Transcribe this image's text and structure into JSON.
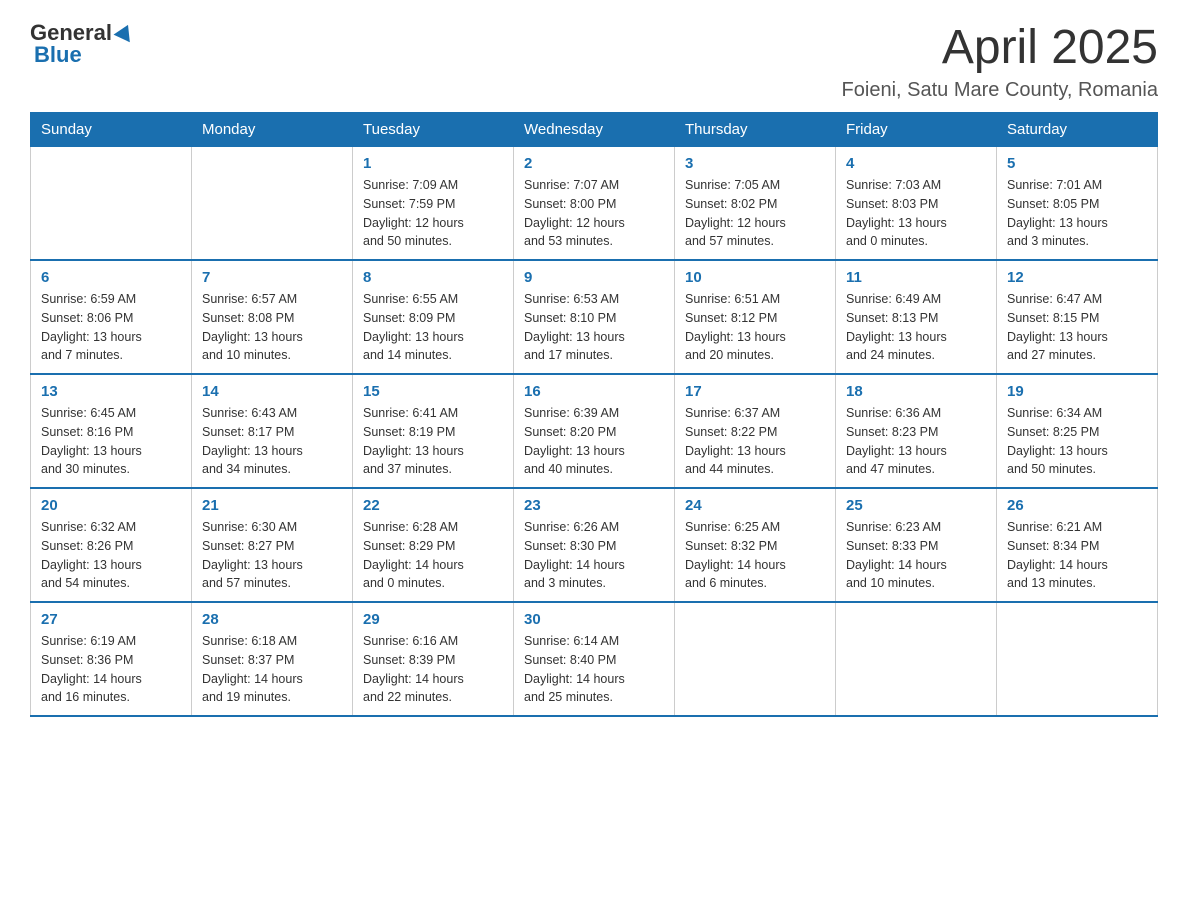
{
  "header": {
    "logo_general": "General",
    "logo_blue": "Blue",
    "month_title": "April 2025",
    "location": "Foieni, Satu Mare County, Romania"
  },
  "weekdays": [
    "Sunday",
    "Monday",
    "Tuesday",
    "Wednesday",
    "Thursday",
    "Friday",
    "Saturday"
  ],
  "weeks": [
    [
      {
        "day": "",
        "info": ""
      },
      {
        "day": "",
        "info": ""
      },
      {
        "day": "1",
        "info": "Sunrise: 7:09 AM\nSunset: 7:59 PM\nDaylight: 12 hours\nand 50 minutes."
      },
      {
        "day": "2",
        "info": "Sunrise: 7:07 AM\nSunset: 8:00 PM\nDaylight: 12 hours\nand 53 minutes."
      },
      {
        "day": "3",
        "info": "Sunrise: 7:05 AM\nSunset: 8:02 PM\nDaylight: 12 hours\nand 57 minutes."
      },
      {
        "day": "4",
        "info": "Sunrise: 7:03 AM\nSunset: 8:03 PM\nDaylight: 13 hours\nand 0 minutes."
      },
      {
        "day": "5",
        "info": "Sunrise: 7:01 AM\nSunset: 8:05 PM\nDaylight: 13 hours\nand 3 minutes."
      }
    ],
    [
      {
        "day": "6",
        "info": "Sunrise: 6:59 AM\nSunset: 8:06 PM\nDaylight: 13 hours\nand 7 minutes."
      },
      {
        "day": "7",
        "info": "Sunrise: 6:57 AM\nSunset: 8:08 PM\nDaylight: 13 hours\nand 10 minutes."
      },
      {
        "day": "8",
        "info": "Sunrise: 6:55 AM\nSunset: 8:09 PM\nDaylight: 13 hours\nand 14 minutes."
      },
      {
        "day": "9",
        "info": "Sunrise: 6:53 AM\nSunset: 8:10 PM\nDaylight: 13 hours\nand 17 minutes."
      },
      {
        "day": "10",
        "info": "Sunrise: 6:51 AM\nSunset: 8:12 PM\nDaylight: 13 hours\nand 20 minutes."
      },
      {
        "day": "11",
        "info": "Sunrise: 6:49 AM\nSunset: 8:13 PM\nDaylight: 13 hours\nand 24 minutes."
      },
      {
        "day": "12",
        "info": "Sunrise: 6:47 AM\nSunset: 8:15 PM\nDaylight: 13 hours\nand 27 minutes."
      }
    ],
    [
      {
        "day": "13",
        "info": "Sunrise: 6:45 AM\nSunset: 8:16 PM\nDaylight: 13 hours\nand 30 minutes."
      },
      {
        "day": "14",
        "info": "Sunrise: 6:43 AM\nSunset: 8:17 PM\nDaylight: 13 hours\nand 34 minutes."
      },
      {
        "day": "15",
        "info": "Sunrise: 6:41 AM\nSunset: 8:19 PM\nDaylight: 13 hours\nand 37 minutes."
      },
      {
        "day": "16",
        "info": "Sunrise: 6:39 AM\nSunset: 8:20 PM\nDaylight: 13 hours\nand 40 minutes."
      },
      {
        "day": "17",
        "info": "Sunrise: 6:37 AM\nSunset: 8:22 PM\nDaylight: 13 hours\nand 44 minutes."
      },
      {
        "day": "18",
        "info": "Sunrise: 6:36 AM\nSunset: 8:23 PM\nDaylight: 13 hours\nand 47 minutes."
      },
      {
        "day": "19",
        "info": "Sunrise: 6:34 AM\nSunset: 8:25 PM\nDaylight: 13 hours\nand 50 minutes."
      }
    ],
    [
      {
        "day": "20",
        "info": "Sunrise: 6:32 AM\nSunset: 8:26 PM\nDaylight: 13 hours\nand 54 minutes."
      },
      {
        "day": "21",
        "info": "Sunrise: 6:30 AM\nSunset: 8:27 PM\nDaylight: 13 hours\nand 57 minutes."
      },
      {
        "day": "22",
        "info": "Sunrise: 6:28 AM\nSunset: 8:29 PM\nDaylight: 14 hours\nand 0 minutes."
      },
      {
        "day": "23",
        "info": "Sunrise: 6:26 AM\nSunset: 8:30 PM\nDaylight: 14 hours\nand 3 minutes."
      },
      {
        "day": "24",
        "info": "Sunrise: 6:25 AM\nSunset: 8:32 PM\nDaylight: 14 hours\nand 6 minutes."
      },
      {
        "day": "25",
        "info": "Sunrise: 6:23 AM\nSunset: 8:33 PM\nDaylight: 14 hours\nand 10 minutes."
      },
      {
        "day": "26",
        "info": "Sunrise: 6:21 AM\nSunset: 8:34 PM\nDaylight: 14 hours\nand 13 minutes."
      }
    ],
    [
      {
        "day": "27",
        "info": "Sunrise: 6:19 AM\nSunset: 8:36 PM\nDaylight: 14 hours\nand 16 minutes."
      },
      {
        "day": "28",
        "info": "Sunrise: 6:18 AM\nSunset: 8:37 PM\nDaylight: 14 hours\nand 19 minutes."
      },
      {
        "day": "29",
        "info": "Sunrise: 6:16 AM\nSunset: 8:39 PM\nDaylight: 14 hours\nand 22 minutes."
      },
      {
        "day": "30",
        "info": "Sunrise: 6:14 AM\nSunset: 8:40 PM\nDaylight: 14 hours\nand 25 minutes."
      },
      {
        "day": "",
        "info": ""
      },
      {
        "day": "",
        "info": ""
      },
      {
        "day": "",
        "info": ""
      }
    ]
  ]
}
